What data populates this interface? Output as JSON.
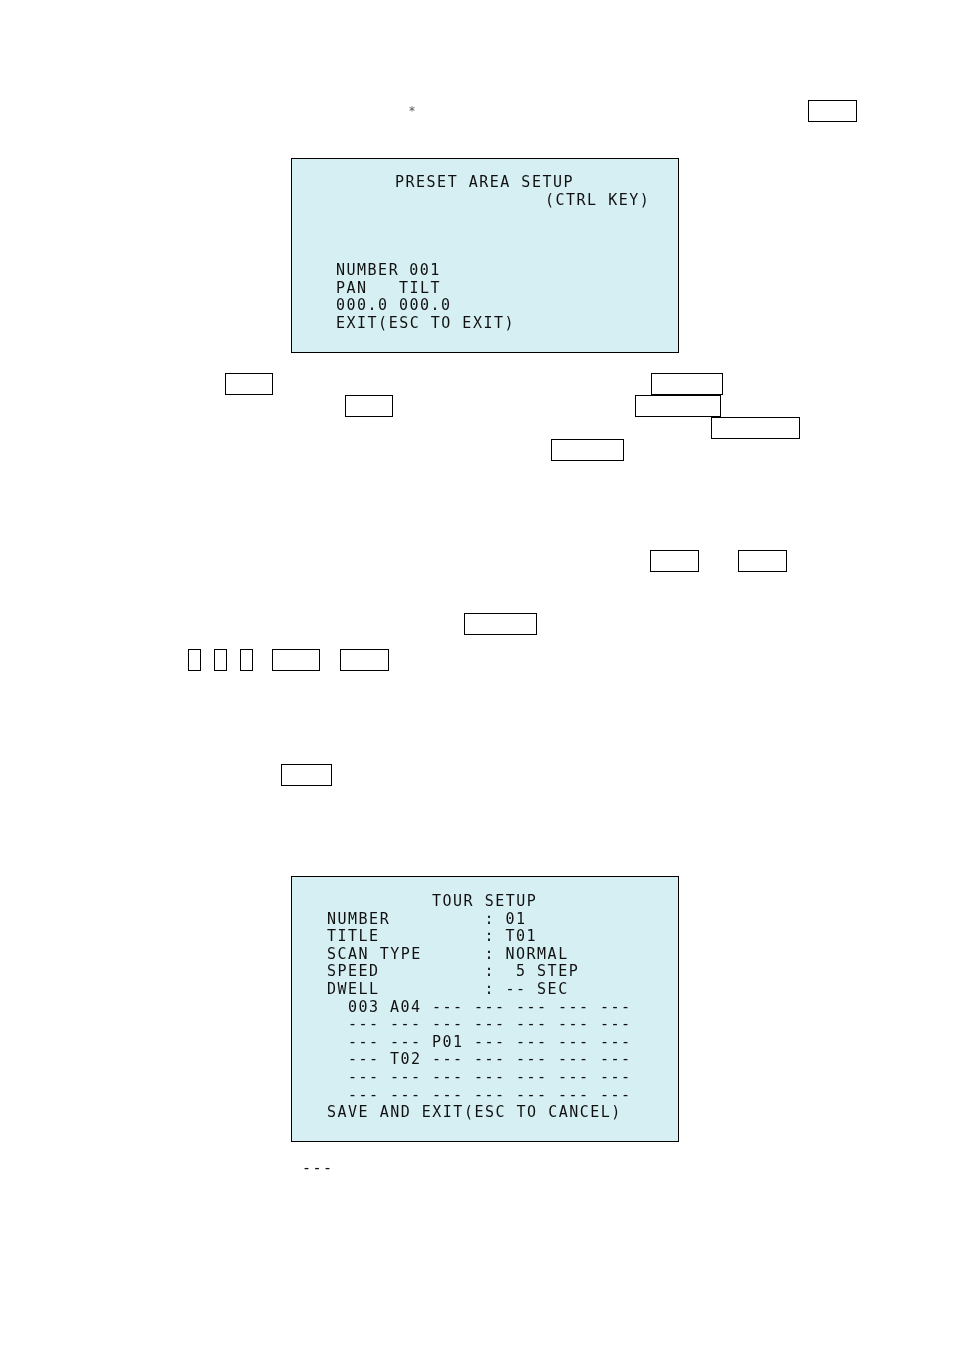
{
  "header": {
    "mark": "*",
    "key_boxes": [
      {
        "kind": "empty"
      }
    ]
  },
  "preset_area_setup": {
    "title": "PRESET AREA SETUP",
    "subtitle": "(CTRL KEY)",
    "number_label": "NUMBER",
    "number": "001",
    "axis_labels": [
      "PAN",
      "TILT"
    ],
    "axis_values": [
      "000.0",
      "000.0"
    ],
    "exit_hint": "EXIT(ESC TO EXIT)"
  },
  "key_box_rows": [
    {
      "key_boxes": [
        {
          "kind": "empty"
        },
        {
          "kind": "empty"
        }
      ]
    },
    {
      "key_boxes": [
        {
          "kind": "empty"
        },
        {
          "kind": "empty"
        }
      ]
    },
    {
      "key_boxes": [
        {
          "kind": "empty"
        }
      ]
    },
    {
      "key_boxes": [
        {
          "kind": "empty"
        }
      ]
    },
    {
      "key_boxes": [
        {
          "kind": "empty"
        },
        {
          "kind": "empty"
        }
      ]
    },
    {
      "key_boxes": [
        {
          "kind": "empty"
        }
      ]
    },
    {
      "key_boxes": [
        {
          "kind": "empty"
        },
        {
          "kind": "empty"
        },
        {
          "kind": "empty"
        },
        {
          "kind": "empty"
        },
        {
          "kind": "empty"
        }
      ]
    },
    {
      "key_boxes": [
        {
          "kind": "empty"
        }
      ]
    }
  ],
  "tour_setup": {
    "title": "TOUR SETUP",
    "fields": [
      {
        "label": "NUMBER",
        "separator": ":",
        "value": "01"
      },
      {
        "label": "TITLE",
        "separator": ":",
        "value": "T01"
      },
      {
        "label": "SCAN TYPE",
        "separator": ":",
        "value": "NORMAL"
      },
      {
        "label": "SPEED",
        "separator": ":",
        "value": " 5 STEP"
      },
      {
        "label": "DWELL",
        "separator": ":",
        "value": "-- SEC"
      }
    ],
    "steps": [
      [
        "003",
        "A04",
        "---",
        "---",
        "---",
        "---",
        "---"
      ],
      [
        "---",
        "---",
        "---",
        "---",
        "---",
        "---",
        "---"
      ],
      [
        "---",
        "---",
        "P01",
        "---",
        "---",
        "---",
        "---"
      ],
      [
        "---",
        "T02",
        "---",
        "---",
        "---",
        "---",
        "---"
      ],
      [
        "---",
        "---",
        "---",
        "---",
        "---",
        "---",
        "---"
      ],
      [
        "---",
        "---",
        "---",
        "---",
        "---",
        "---",
        "---"
      ]
    ],
    "footer": "SAVE AND EXIT(ESC TO CANCEL)"
  },
  "trailing_text": "---"
}
